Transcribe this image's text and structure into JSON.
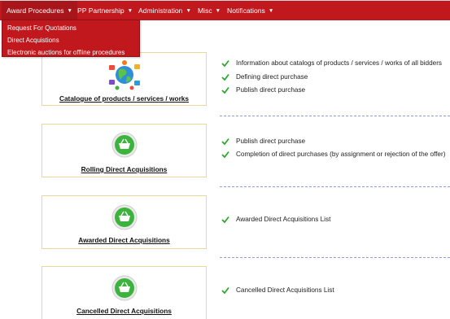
{
  "nav": {
    "items": [
      {
        "label": "Award Procedures"
      },
      {
        "label": "PP Partnership"
      },
      {
        "label": "Administration"
      },
      {
        "label": "Misc"
      },
      {
        "label": "Notifications"
      }
    ],
    "caret": "▼"
  },
  "dropdown": {
    "items": [
      {
        "label": "Request For Quotations"
      },
      {
        "label": "Direct Acquistions"
      },
      {
        "label": "Electronic auctions for offline procedures"
      }
    ]
  },
  "sections": [
    {
      "title": "Catalogue of products / services / works",
      "icon": "globe-icon",
      "features": [
        "Information about catalogs of products / services / works of all bidders",
        "Defining direct purchase",
        "Publish direct purchase"
      ]
    },
    {
      "title": "Rolling Direct Acquisitions",
      "icon": "shopping-basket-icon",
      "features": [
        "Publish direct purchase",
        "Completion of direct purchases (by assignment or rejection of the offer)"
      ]
    },
    {
      "title": "Awarded Direct Acquisitions",
      "icon": "shopping-basket-icon",
      "features": [
        "Awarded Direct Acquisitions List"
      ]
    },
    {
      "title": "Cancelled Direct Acquisitions",
      "icon": "shopping-basket-icon",
      "features": [
        "Cancelled Direct Acquisitions List"
      ]
    }
  ],
  "colors": {
    "nav_bg": "#c0181d",
    "card_border": "#ecd79a",
    "check_green": "#2ea82e",
    "divider": "#8da0d6",
    "icon_green": "#3cb33c"
  }
}
